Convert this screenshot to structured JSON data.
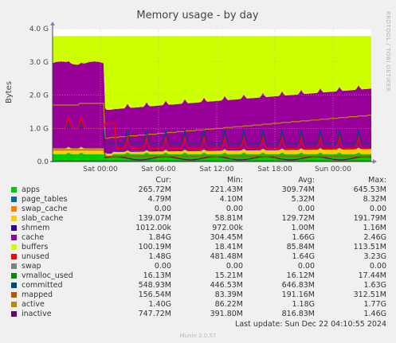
{
  "chart_data": {
    "type": "area",
    "title": "Memory usage - by day",
    "ylabel": "Bytes",
    "side_label": "RRDTOOL / TOBI OETIKER",
    "ylim": [
      0,
      4.0
    ],
    "y_unit": "G",
    "y_ticks": [
      "0.0",
      "1.0 G",
      "2.0 G",
      "3.0 G",
      "4.0 G"
    ],
    "x_ticks": [
      "Sat 00:00",
      "Sat 06:00",
      "Sat 12:00",
      "Sat 18:00",
      "Sun 00:00"
    ],
    "columns": [
      "Cur:",
      "Min:",
      "Avg:",
      "Max:"
    ],
    "series": [
      {
        "name": "apps",
        "color": "#00cc00",
        "cur": "265.72M",
        "min": "221.43M",
        "avg": "309.74M",
        "max": "645.53M"
      },
      {
        "name": "page_tables",
        "color": "#0066b3",
        "cur": "4.79M",
        "min": "4.10M",
        "avg": "5.32M",
        "max": "8.32M"
      },
      {
        "name": "swap_cache",
        "color": "#ff8000",
        "cur": "0.00",
        "min": "0.00",
        "avg": "0.00",
        "max": "0.00"
      },
      {
        "name": "slab_cache",
        "color": "#ffcc00",
        "cur": "139.07M",
        "min": "58.81M",
        "avg": "129.72M",
        "max": "191.79M"
      },
      {
        "name": "shmem",
        "color": "#330099",
        "cur": "1012.00k",
        "min": "972.00k",
        "avg": "1.00M",
        "max": "1.16M"
      },
      {
        "name": "cache",
        "color": "#990099",
        "cur": "1.84G",
        "min": "304.45M",
        "avg": "1.66G",
        "max": "2.46G"
      },
      {
        "name": "buffers",
        "color": "#ccff00",
        "cur": "100.19M",
        "min": "18.41M",
        "avg": "85.84M",
        "max": "113.51M"
      },
      {
        "name": "unused",
        "color": "#ff0000",
        "cur": "1.48G",
        "min": "481.48M",
        "avg": "1.64G",
        "max": "3.23G"
      },
      {
        "name": "swap",
        "color": "#808080",
        "cur": "0.00",
        "min": "0.00",
        "avg": "0.00",
        "max": "0.00"
      },
      {
        "name": "vmalloc_used",
        "color": "#008f00",
        "cur": "16.13M",
        "min": "15.21M",
        "avg": "16.12M",
        "max": "17.44M"
      },
      {
        "name": "committed",
        "color": "#00487d",
        "cur": "548.93M",
        "min": "446.53M",
        "avg": "646.83M",
        "max": "1.63G"
      },
      {
        "name": "mapped",
        "color": "#b35a00",
        "cur": "156.54M",
        "min": "83.39M",
        "avg": "191.16M",
        "max": "312.51M"
      },
      {
        "name": "active",
        "color": "#b38f00",
        "cur": "1.40G",
        "min": "86.22M",
        "avg": "1.18G",
        "max": "1.77G"
      },
      {
        "name": "inactive",
        "color": "#6b006b",
        "cur": "747.72M",
        "min": "391.80M",
        "avg": "816.83M",
        "max": "1.46G"
      }
    ]
  },
  "footer": {
    "last_update": "Last update: Sun Dec 22 04:10:55 2024",
    "munin_version": "Munin 2.0.57"
  }
}
